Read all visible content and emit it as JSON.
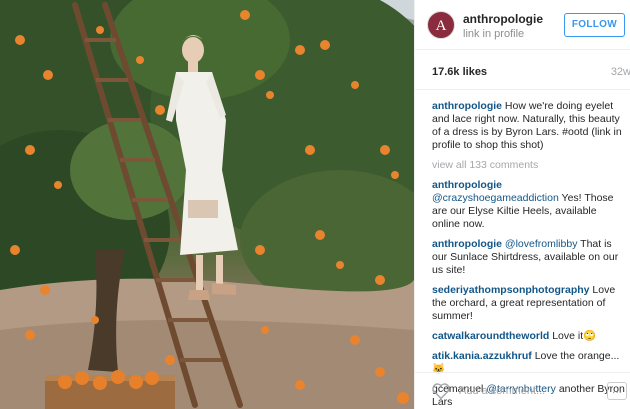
{
  "post": {
    "photo_icon": "orange-orchard-photo"
  },
  "header": {
    "avatar_letter": "A",
    "username": "anthropologie",
    "subtitle": "link in profile",
    "follow_label": "FOLLOW"
  },
  "stats": {
    "likes": "17.6k likes",
    "age": "32w"
  },
  "caption": {
    "user": "anthropologie",
    "text": " How we're doing eyelet and lace right now. Naturally, this beauty of a dress is by Byron Lars. #ootd (link in profile to shop this shot)"
  },
  "view_all": "view all 133 comments",
  "comments": [
    {
      "user": "anthropologie",
      "mention": "@crazyshoegameaddiction",
      "text": " Yes! Those are our Elyse Kiltie Heels, available online now."
    },
    {
      "user": "anthropologie",
      "mention": "@lovefromlibby",
      "text": " That is our Sunlace Shirtdress, available on our us site!"
    },
    {
      "user": "sederiyathompsonphotography",
      "mention": "",
      "text": " Love the orchard, a great representation of summer!"
    },
    {
      "user": "catwalkaroundtheworld",
      "mention": "",
      "text": " Love it🙄"
    },
    {
      "user": "atik.kania.azzukhruf",
      "mention": "",
      "text": " Love the orange...🐱"
    },
    {
      "user": "gcemanuel",
      "mention": "@tarrynbuttery",
      "text": " another Byron Lars"
    }
  ],
  "footer": {
    "add_comment_placeholder": "Add a comment...",
    "more_label": "..."
  },
  "colors": {
    "link": "#125688",
    "follow_blue": "#3897f0",
    "muted": "#a5a7aa"
  }
}
